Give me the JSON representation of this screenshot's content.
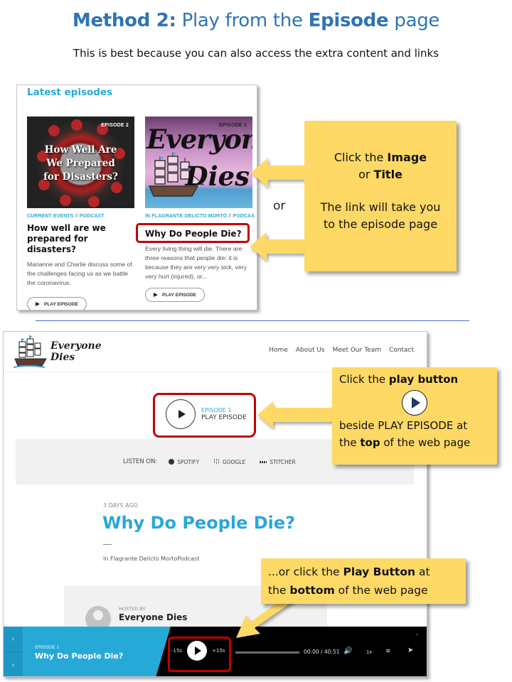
{
  "heading": {
    "bold1": "Method 2:",
    "text1": " Play from the ",
    "bold2": "Episode",
    "text2": " page"
  },
  "subheading": "This is best because you can also access the extra content and links",
  "latest": {
    "section_title": "Latest episodes",
    "episodes": [
      {
        "badge": "EPISODE 2",
        "image_text": [
          "How Well Are",
          "We Prepared",
          "for Disasters?"
        ],
        "category_a": "CURRENT EVENTS",
        "category_sep": " // ",
        "category_b": "PODCAST",
        "title": "How well are we prepared for disasters?",
        "description": "Marianne and Charlie discuss some of the challenges facing us as we battle the coronavirus.",
        "play_label": "PLAY EPISODE"
      },
      {
        "badge": "EPISODE 1",
        "image_text": [
          "Everyone",
          "Dies"
        ],
        "category_a": "IN FLAGRANTE DELICTO MORTO",
        "category_sep": " // ",
        "category_b": "PODCAS",
        "title": "Why Do People Die?",
        "description": "Every living thing will die. There are three reasons that people die: it is because they are very very sick, very very hurt (injured), or...",
        "play_label": "PLAY EPISODE"
      }
    ]
  },
  "or_label": "or",
  "callouts": {
    "c1": {
      "line1_pre": "Click the ",
      "line1_bold": "Image",
      "line2_pre": "or ",
      "line2_bold": "Title",
      "line3": "The link will take you",
      "line4": "to the episode page"
    },
    "c2": {
      "line1_pre": "Click the ",
      "line1_bold": "play button",
      "line2": "beside PLAY EPISODE at",
      "line3_pre": "the ",
      "line3_bold": "top",
      "line3_post": " of the web page"
    },
    "c3": {
      "line1_pre": "...or click the ",
      "line1_bold": "Play Button",
      "line1_post": " at",
      "line2_pre": "the ",
      "line2_bold": "bottom",
      "line2_post": " of the web page"
    },
    "highlight_color": "#c00000",
    "callout_color": "#ffd966"
  },
  "episode_page": {
    "logo_text": "Everyone Dies",
    "nav": [
      "Home",
      "About Us",
      "Meet Our Team",
      "Contact"
    ],
    "top_player": {
      "episode_label": "EPISODE 1",
      "play_label": "PLAY EPISODE"
    },
    "listen_on": {
      "label": "LISTEN ON:",
      "services": [
        "SPOTIFY",
        "GOOGLE",
        "STITCHER"
      ]
    },
    "posted": "3 DAYS AGO",
    "title": "Why Do People Die?",
    "category": "In Flagrante Delicto MortoPodcast",
    "host": {
      "label": "HOSTED BY",
      "name": "Everyone Dies"
    },
    "player_bar": {
      "episode_label": "EPISODE 1",
      "title": "Why Do People Die?",
      "back": "-15s",
      "forward": "+15s",
      "time": "00:00 / 40:51",
      "speed": "1x",
      "progress": 0,
      "accent": "#27a9d8"
    }
  }
}
